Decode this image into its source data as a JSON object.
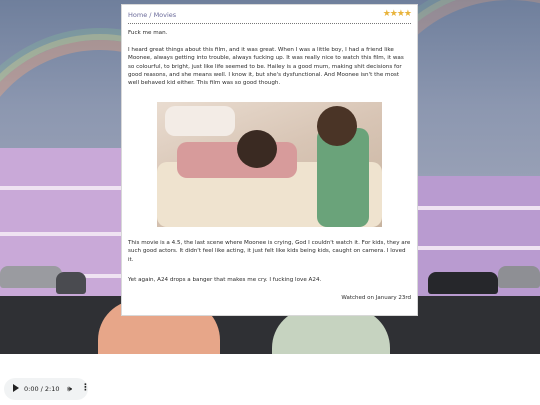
{
  "breadcrumb": {
    "home": "Home",
    "separator": "/",
    "section": "Movies"
  },
  "rating": {
    "stars": "★★★★",
    "count": 4
  },
  "review": {
    "headline": "Fuck me man.",
    "paragraph1": "I heard great things about this film, and it was great. When I was a little boy, I had a friend like Moonee, always getting into trouble, always fucking up. It was really nice to watch this film, it was so colourful, to bright, just like life seemed to be. Hailey is a good mum, making shit decisions for good reasons, and she means well. I know it, but she's dysfunctional. And Moonee isn't the most well behaved kid either. This film was so good though.",
    "paragraph2": "This movie is a 4.5, the last scene where Moonee is crying, God I couldn't watch it. For kids, they are such good actors. It didn't feel like acting, it just felt like kids being kids, caught on camera. I loved it.",
    "paragraph3": "Yet again, A24 drops a banger that makes me cry. I fucking love A24.",
    "watched": "Watched on January 23rd"
  },
  "audio_player": {
    "time": "0:00 / 2:10",
    "play_icon": "play-icon",
    "volume_icon": "volume-icon",
    "more_icon": "more-vertical-icon"
  },
  "colors": {
    "star": "#e8b33a",
    "link": "#6a6a9a",
    "card": "#ffffff"
  }
}
